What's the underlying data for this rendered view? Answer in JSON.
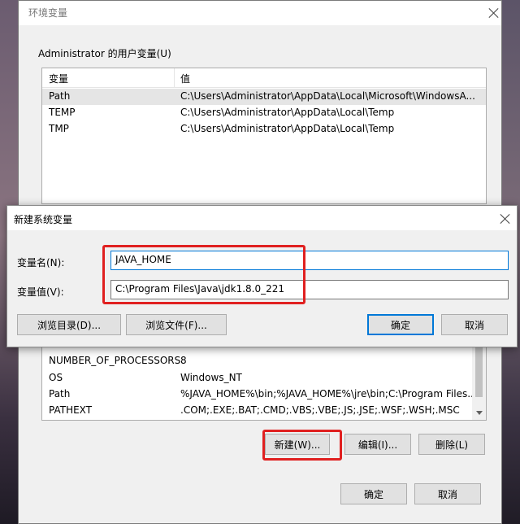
{
  "env_window": {
    "title": "环境变量",
    "user_group_label": "Administrator 的用户变量(U)",
    "columns": {
      "name": "变量",
      "value": "值"
    },
    "user_vars": [
      {
        "name": "Path",
        "value": "C:\\Users\\Administrator\\AppData\\Local\\Microsoft\\WindowsA..."
      },
      {
        "name": "TEMP",
        "value": "C:\\Users\\Administrator\\AppData\\Local\\Temp"
      },
      {
        "name": "TMP",
        "value": "C:\\Users\\Administrator\\AppData\\Local\\Temp"
      }
    ],
    "system_vars": [
      {
        "name": "NUMBER_OF_PROCESSORS",
        "value": "8"
      },
      {
        "name": "OS",
        "value": "Windows_NT"
      },
      {
        "name": "Path",
        "value": "%JAVA_HOME%\\bin;%JAVA_HOME%\\jre\\bin;C:\\Program Files..."
      },
      {
        "name": "PATHEXT",
        "value": ".COM;.EXE;.BAT;.CMD;.VBS;.VBE;.JS;.JSE;.WSF;.WSH;.MSC"
      }
    ],
    "system_buttons": {
      "new": "新建(W)...",
      "edit": "编辑(I)...",
      "delete": "删除(L)"
    },
    "ok": "确定",
    "cancel": "取消"
  },
  "dialog": {
    "title": "新建系统变量",
    "name_label": "变量名(N):",
    "name_value": "JAVA_HOME",
    "value_label": "变量值(V):",
    "value_value": "C:\\Program Files\\Java\\jdk1.8.0_221",
    "browse_dir": "浏览目录(D)...",
    "browse_file": "浏览文件(F)...",
    "ok": "确定",
    "cancel": "取消"
  },
  "colors": {
    "highlight_box": "#e02020",
    "focus_border": "#0078d7"
  }
}
